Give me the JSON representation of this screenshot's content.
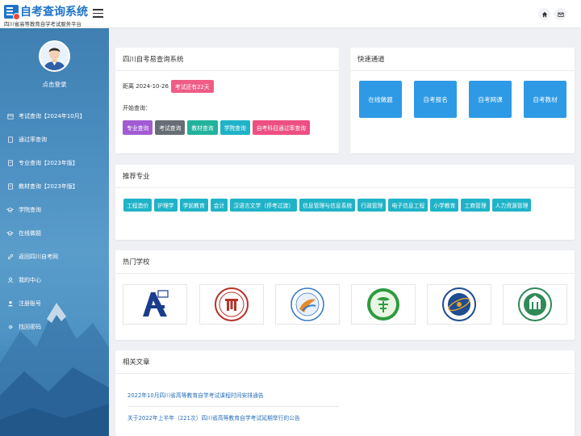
{
  "header": {
    "title": "自考查询系统",
    "subtitle": "四川省高等教育自学考试服务平台",
    "home_icon": "home-icon",
    "mail_icon": "mail-icon"
  },
  "sidebar": {
    "login_label": "点击登录",
    "items": [
      {
        "label": "考试查询【2024年10月】",
        "icon": "calendar-icon"
      },
      {
        "label": "通过率查询",
        "icon": "document-icon"
      },
      {
        "label": "专业查询【2023年版】",
        "icon": "document-icon"
      },
      {
        "label": "教材查询【2023年版】",
        "icon": "document-icon"
      },
      {
        "label": "学院查询",
        "icon": "graduation-cap-icon"
      },
      {
        "label": "在线做题",
        "icon": "graduation-cap-icon"
      },
      {
        "label": "返回四川自考网",
        "icon": "link-icon"
      },
      {
        "label": "我的中心",
        "icon": "user-icon"
      },
      {
        "label": "注册账号",
        "icon": "user-icon"
      },
      {
        "label": "找回密码",
        "icon": "gear-icon"
      }
    ]
  },
  "query_card": {
    "title": "四川自考易查询系统",
    "date_text": "距离 2024-10-26",
    "countdown": "考试还有22天",
    "start_label": "开始查询：",
    "buttons": [
      "专业查询",
      "考试查询",
      "教材查询",
      "学院查询",
      "自考科目通过率查询"
    ]
  },
  "quick_card": {
    "title": "快速通道",
    "buttons": [
      "在线做题",
      "自考报名",
      "自考网课",
      "自考教材"
    ]
  },
  "majors_card": {
    "title": "推荐专业",
    "majors": [
      "工程造价",
      "护理学",
      "学前教育",
      "会计",
      "汉语言文学（停考过渡）",
      "信息管理与信息系统",
      "行政管理",
      "电子信息工程",
      "小学教育",
      "工商管理",
      "人力资源管理"
    ]
  },
  "schools_card": {
    "title": "热门学校"
  },
  "articles_card": {
    "title": "相关文章",
    "articles": [
      "2022年10月四川省高等教育自学考试课程时间安排通告",
      "关于2022年上半年（221次）四川省高等教育自学考试延期举行的公告"
    ]
  },
  "colors": {
    "brand": "#1e73c8",
    "quick": "#2e9ae6",
    "major": "#1fb3c8",
    "countdown": "#ef5d87"
  }
}
